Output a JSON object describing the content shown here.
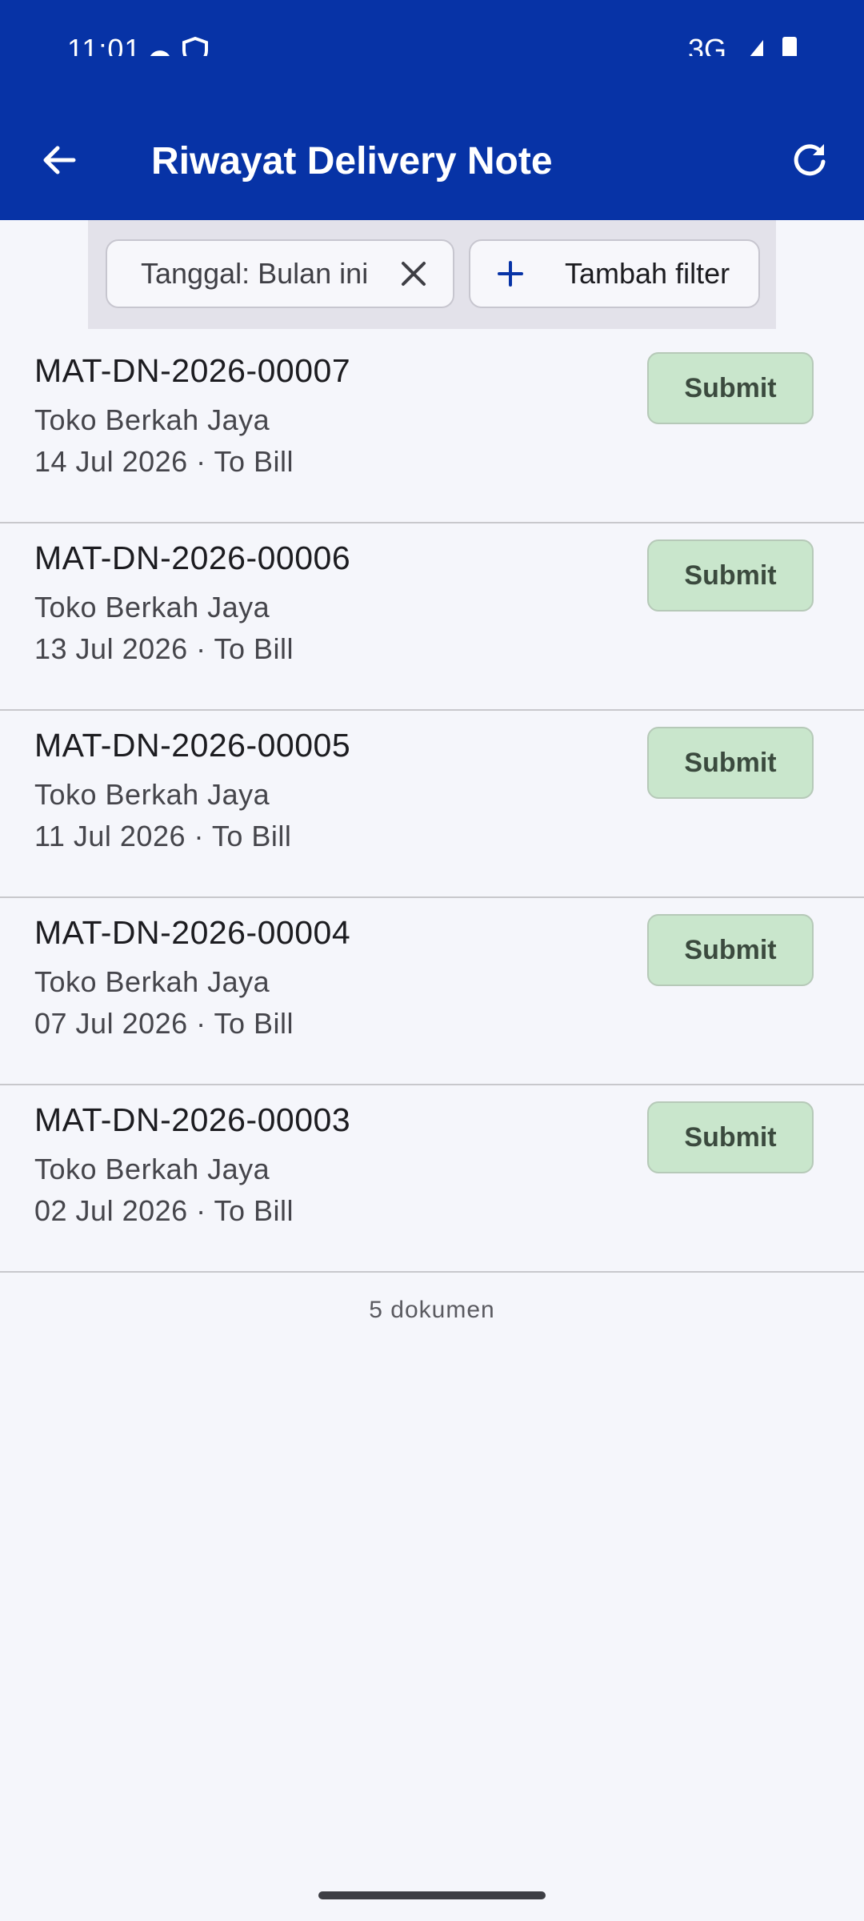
{
  "status_bar": {
    "time": "11:01",
    "network": "3G",
    "icons": [
      "cloud-icon",
      "shield-icon",
      "signal-icon",
      "battery-icon"
    ]
  },
  "app_bar": {
    "title": "Riwayat Delivery Note",
    "background": "#0733a6",
    "back_icon": "arrow-back-icon",
    "refresh_icon": "refresh-icon"
  },
  "filters": {
    "active_chip_label": "Tanggal: Bulan ini",
    "add_filter_label": "Tambah filter"
  },
  "delivery_notes": [
    {
      "id": "MAT-DN-2026-00007",
      "customer": "Toko Berkah Jaya",
      "meta": "14 Jul 2026 · To Bill",
      "action": "Submit"
    },
    {
      "id": "MAT-DN-2026-00006",
      "customer": "Toko Berkah Jaya",
      "meta": "13 Jul 2026 · To Bill",
      "action": "Submit"
    },
    {
      "id": "MAT-DN-2026-00005",
      "customer": "Toko Berkah Jaya",
      "meta": "11 Jul 2026 · To Bill",
      "action": "Submit"
    },
    {
      "id": "MAT-DN-2026-00004",
      "customer": "Toko Berkah Jaya",
      "meta": "07 Jul 2026 · To Bill",
      "action": "Submit"
    },
    {
      "id": "MAT-DN-2026-00003",
      "customer": "Toko Berkah Jaya",
      "meta": "02 Jul 2026 · To Bill",
      "action": "Submit"
    }
  ],
  "footer": {
    "count_label": "5 dokumen"
  },
  "colors": {
    "submit_bg": "#c9e6cc",
    "page_bg": "#f5f6fb"
  }
}
